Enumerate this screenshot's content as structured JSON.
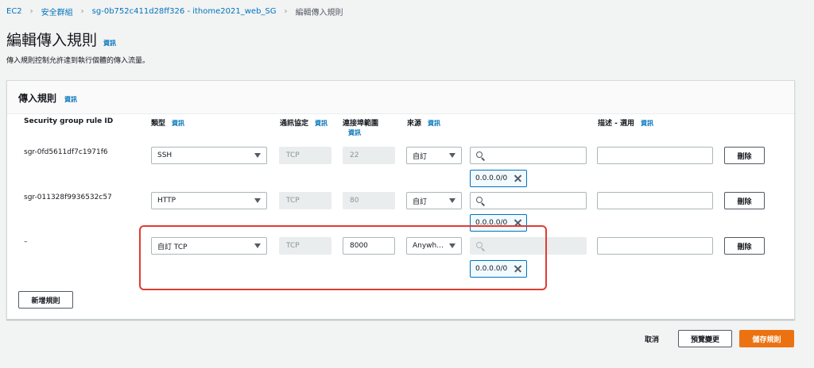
{
  "breadcrumb": [
    "EC2",
    "安全群組",
    "sg-0b752c411d28ff326 - ithome2021_web_SG",
    "編輯傳入規則"
  ],
  "page": {
    "title": "編輯傳入規則",
    "info": "資訊",
    "description": "傳入規則控制允許達到執行個體的傳入流量。"
  },
  "panel": {
    "title": "傳入規則",
    "info": "資訊",
    "columns": {
      "rule_id": "Security group rule ID",
      "type": "類型",
      "protocol": "通訊協定",
      "port_range": "連接埠範圍",
      "source": "來源",
      "description": "描述 - 選用",
      "info": "資訊"
    },
    "rules": [
      {
        "id": "sgr-0fd5611df7c1971f6",
        "type": "SSH",
        "protocol": "TCP",
        "port": "22",
        "source": "自訂",
        "cidr": "0.0.0.0/0",
        "delete": "刪除"
      },
      {
        "id": "sgr-011328f9936532c57",
        "type": "HTTP",
        "protocol": "TCP",
        "port": "80",
        "source": "自訂",
        "cidr": "0.0.0.0/0",
        "delete": "刪除"
      },
      {
        "id": "–",
        "type": "自訂 TCP",
        "protocol": "TCP",
        "port": "8000",
        "source": "Anywh...",
        "cidr": "0.0.0.0/0",
        "delete": "刪除"
      }
    ],
    "add_rule": "新增規則"
  },
  "footer": {
    "cancel": "取消",
    "preview": "預覽變更",
    "save": "儲存規則"
  },
  "colors": {
    "link": "#0073bb",
    "primary": "#ec7211",
    "highlight": "#e03c31"
  }
}
